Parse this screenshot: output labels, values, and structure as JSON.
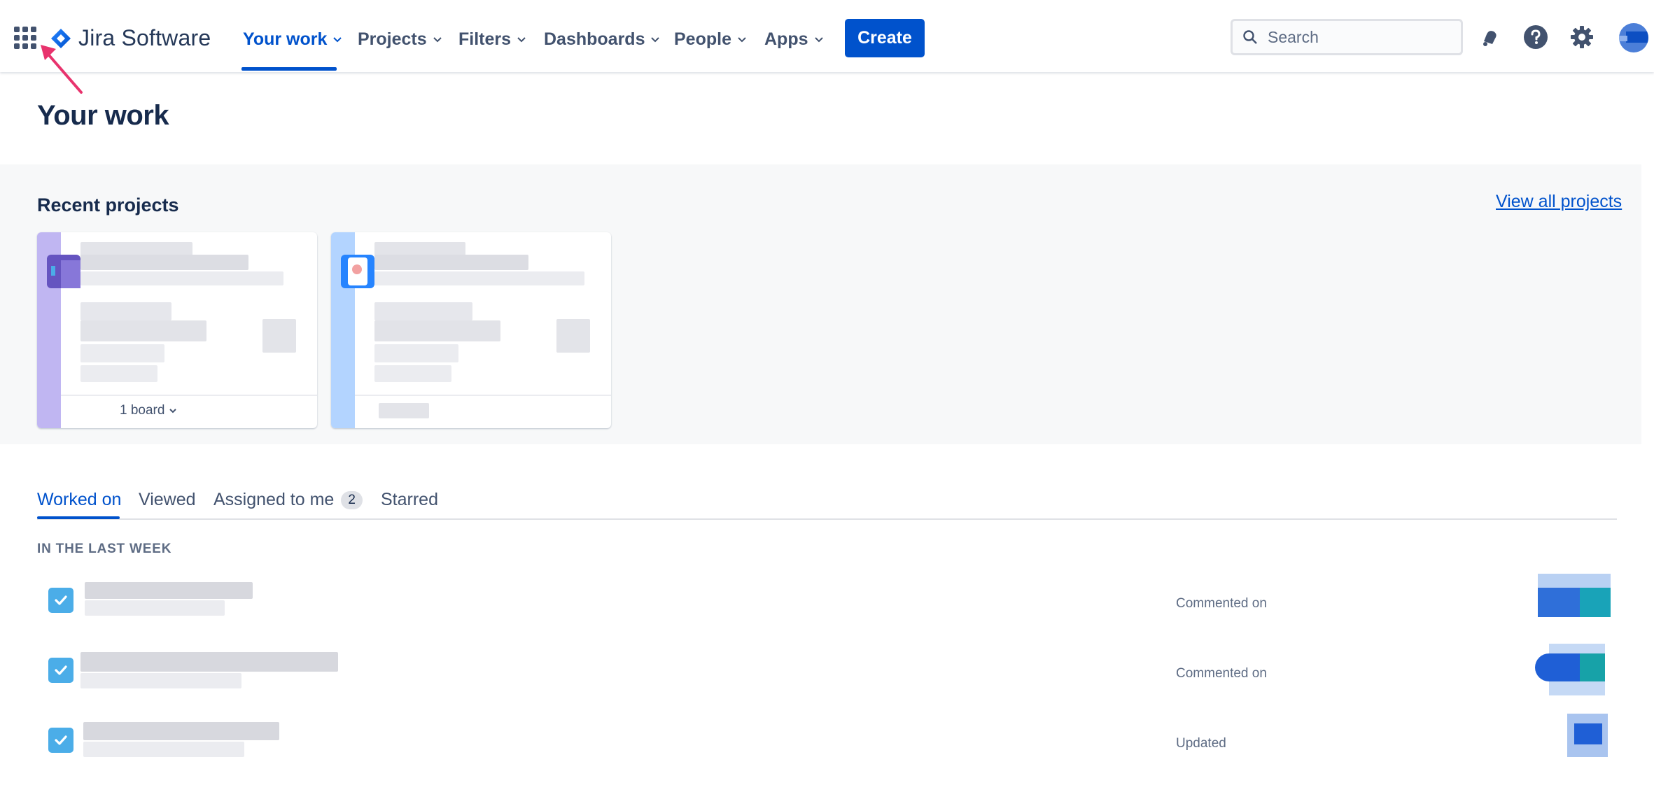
{
  "header": {
    "product_name": "Jira Software",
    "nav": [
      {
        "label": "Your work"
      },
      {
        "label": "Projects"
      },
      {
        "label": "Filters"
      },
      {
        "label": "Dashboards"
      },
      {
        "label": "People"
      },
      {
        "label": "Apps"
      }
    ],
    "create_label": "Create",
    "search_placeholder": "Search",
    "icons": [
      "app-switcher-icon",
      "notifications-icon",
      "help-icon",
      "settings-icon",
      "profile-avatar"
    ]
  },
  "page": {
    "title": "Your work"
  },
  "recent_projects": {
    "title": "Recent projects",
    "view_all_label": "View all projects",
    "cards": [
      {
        "board_label": "1 board",
        "accent": "#c0b6f2"
      },
      {
        "board_label": "",
        "accent": "#b3d4ff"
      }
    ]
  },
  "tabs": {
    "items": [
      {
        "label": "Worked on",
        "active": true
      },
      {
        "label": "Viewed",
        "active": false
      },
      {
        "label": "Assigned to me",
        "count": "2",
        "active": false
      },
      {
        "label": "Starred",
        "active": false
      }
    ]
  },
  "activity": {
    "section_label": "IN THE LAST WEEK",
    "rows": [
      {
        "action": "Commented on"
      },
      {
        "action": "Commented on"
      },
      {
        "action": "Updated"
      }
    ]
  },
  "colors": {
    "brand_blue": "#0052cc",
    "task_blue": "#4bade8",
    "text_primary": "#172b4d",
    "text_subtle": "#5e6c84",
    "annotation_arrow": "#e8336d"
  }
}
